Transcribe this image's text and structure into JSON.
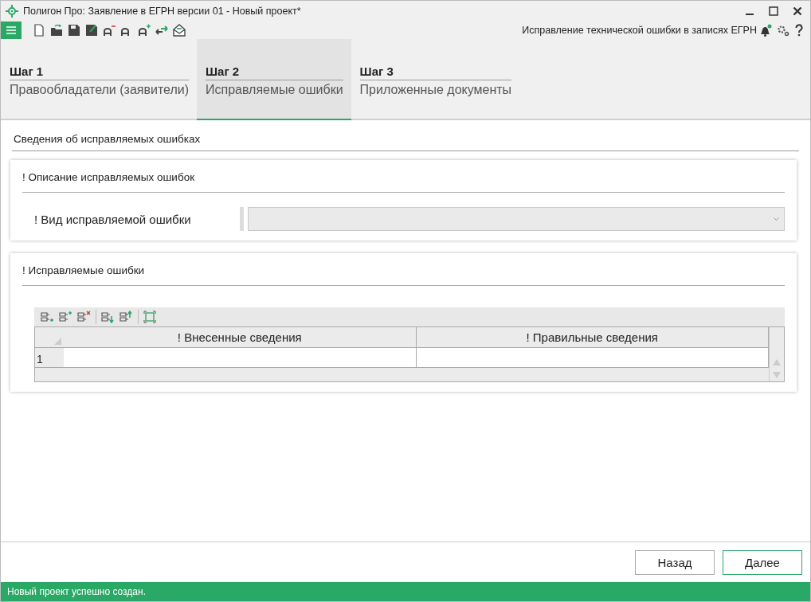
{
  "window": {
    "title": "Полигон Про: Заявление в ЕГРН версии 01 - Новый проект*"
  },
  "toolbar": {
    "mode_label": "Исправление технической ошибки в записях ЕГРН",
    "notification": true
  },
  "steps": [
    {
      "step": "Шаг 1",
      "label": "Правообладатели (заявители)",
      "selected": false
    },
    {
      "step": "Шаг 2",
      "label": "Исправляемые ошибки",
      "selected": true
    },
    {
      "step": "Шаг 3",
      "label": "Приложенные документы",
      "selected": false
    }
  ],
  "section_title": "Сведения об исправляемых ошибках",
  "panels": [
    {
      "kind": "form",
      "title": "! Описание исправляемых ошибок",
      "field_label": "! Вид исправляемой ошибки"
    },
    {
      "kind": "grid",
      "title": "! Исправляемые ошибки",
      "columns": [
        "! Внесенные сведения",
        "! Правильные сведения"
      ],
      "rows": [
        {
          "number": "1"
        }
      ]
    }
  ],
  "buttons": [
    {
      "label": "Назад",
      "primary": false
    },
    {
      "label": "Далее",
      "primary": true
    }
  ],
  "status_bar": "Новый проект успешно создан."
}
